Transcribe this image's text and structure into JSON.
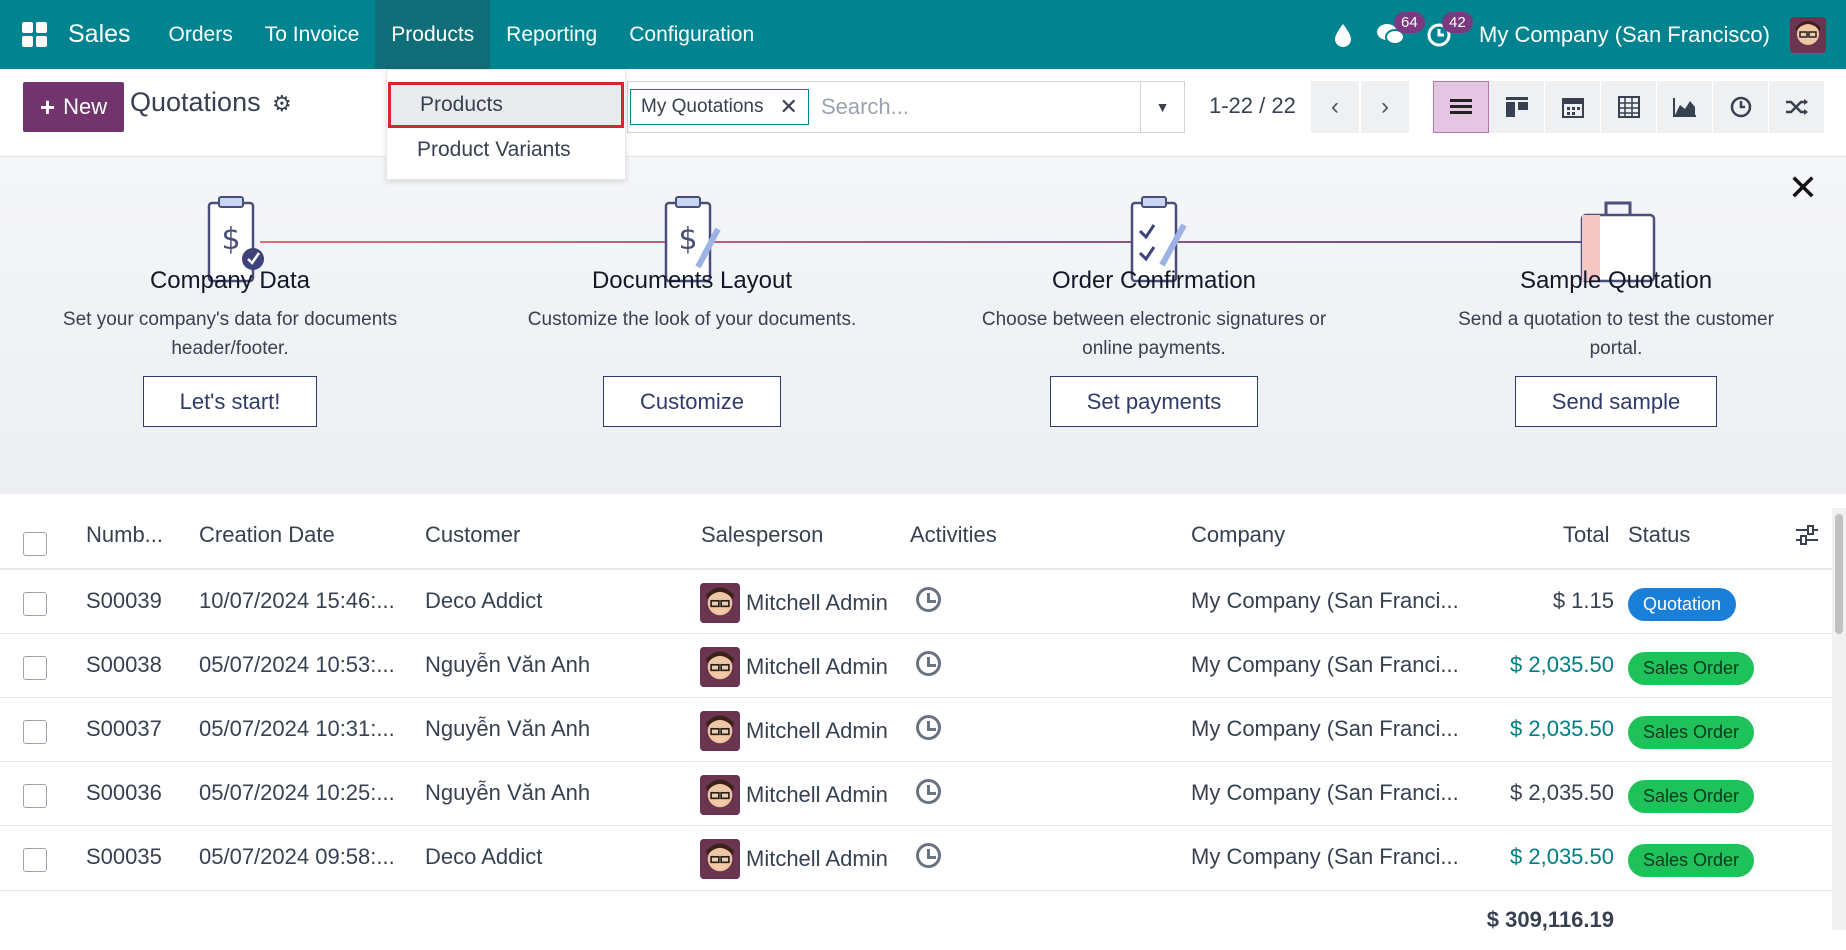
{
  "topbar": {
    "brand": "Sales",
    "menu": [
      {
        "label": "Orders"
      },
      {
        "label": "To Invoice"
      },
      {
        "label": "Products"
      },
      {
        "label": "Reporting"
      },
      {
        "label": "Configuration"
      }
    ],
    "messages_count": "64",
    "activities_count": "42",
    "company": "My Company (San Francisco)"
  },
  "dropdown": {
    "items": [
      "Products",
      "Product Variants"
    ]
  },
  "control": {
    "new_label": "New",
    "title": "Quotations",
    "facet": "My Quotations",
    "search_placeholder": "Search...",
    "pager": "1-22 / 22"
  },
  "helper": {
    "steps": [
      {
        "title": "Company Data",
        "desc": "Set your company's data for documents header/footer.",
        "button": "Let's start!"
      },
      {
        "title": "Documents Layout",
        "desc": "Customize the look of your documents.",
        "button": "Customize"
      },
      {
        "title": "Order Confirmation",
        "desc": "Choose between electronic signatures or online payments.",
        "button": "Set payments"
      },
      {
        "title": "Sample Quotation",
        "desc": "Send a quotation to test the customer portal.",
        "button": "Send sample"
      }
    ]
  },
  "table": {
    "headers": {
      "number": "Numb...",
      "date": "Creation Date",
      "customer": "Customer",
      "salesperson": "Salesperson",
      "activities": "Activities",
      "company": "Company",
      "total": "Total",
      "status": "Status"
    },
    "rows": [
      {
        "number": "S00039",
        "date": "10/07/2024 15:46:...",
        "customer": "Deco Addict",
        "salesperson": "Mitchell Admin",
        "company": "My Company (San Franci...",
        "total": "$ 1.15",
        "status": "Quotation"
      },
      {
        "number": "S00038",
        "date": "05/07/2024 10:53:...",
        "customer": "Nguyễn Văn Anh",
        "salesperson": "Mitchell Admin",
        "company": "My Company (San Franci...",
        "total": "$ 2,035.50",
        "status": "Sales Order"
      },
      {
        "number": "S00037",
        "date": "05/07/2024 10:31:...",
        "customer": "Nguyễn Văn Anh",
        "salesperson": "Mitchell Admin",
        "company": "My Company (San Franci...",
        "total": "$ 2,035.50",
        "status": "Sales Order"
      },
      {
        "number": "S00036",
        "date": "05/07/2024 10:25:...",
        "customer": "Nguyễn Văn Anh",
        "salesperson": "Mitchell Admin",
        "company": "My Company (San Franci...",
        "total": "$ 2,035.50",
        "status": "Sales Order"
      },
      {
        "number": "S00035",
        "date": "05/07/2024 09:58:...",
        "customer": "Deco Addict",
        "salesperson": "Mitchell Admin",
        "company": "My Company (San Franci...",
        "total": "$ 2,035.50",
        "status": "Sales Order"
      }
    ],
    "grand_total": "$ 309,116.19"
  },
  "colors": {
    "topbar": "#018390",
    "primary": "#71346d",
    "quotation": "#1a7fd8",
    "sales_order": "#1fc25a"
  }
}
